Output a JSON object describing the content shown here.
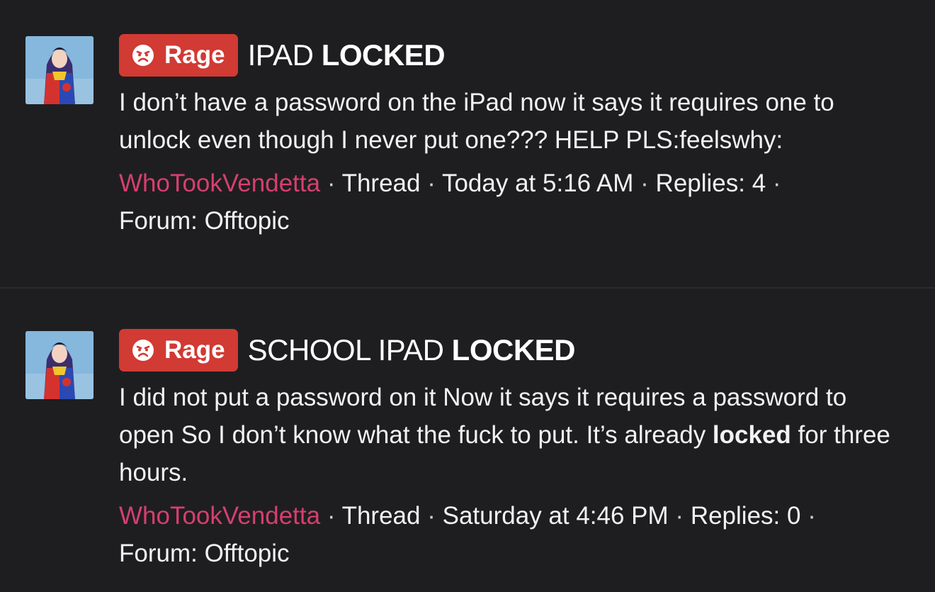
{
  "colors": {
    "background": "#1e1e20",
    "badge": "#d23a34",
    "author": "#d63f6f",
    "text": "#ffffff"
  },
  "results": [
    {
      "avatar_icon": "avatar-image",
      "badge_icon": "angry-face-icon",
      "badge_label": "Rage",
      "title_plain": "IPAD",
      "title_bold": "LOCKED",
      "snippet_before": "I don’t have a password on the iPad now it says it requires one to unlock even though I never put one??? HELP PLS:feelswhy:",
      "snippet_bold": "",
      "snippet_after": "",
      "author": "WhoTookVendetta",
      "type": "Thread",
      "date": "Today at 5:16 AM",
      "replies": "Replies: 4",
      "forum": "Forum: Offtopic"
    },
    {
      "avatar_icon": "avatar-image",
      "badge_icon": "angry-face-icon",
      "badge_label": "Rage",
      "title_plain": "SCHOOL IPAD",
      "title_bold": "LOCKED",
      "snippet_before": "I did not put a password on it Now it says it requires a password to open So I don’t know what the fuck to put. It’s already ",
      "snippet_bold": "locked",
      "snippet_after": " for three hours.",
      "author": "WhoTookVendetta",
      "type": "Thread",
      "date": "Saturday at 4:46 PM",
      "replies": "Replies: 0",
      "forum": "Forum: Offtopic"
    }
  ]
}
